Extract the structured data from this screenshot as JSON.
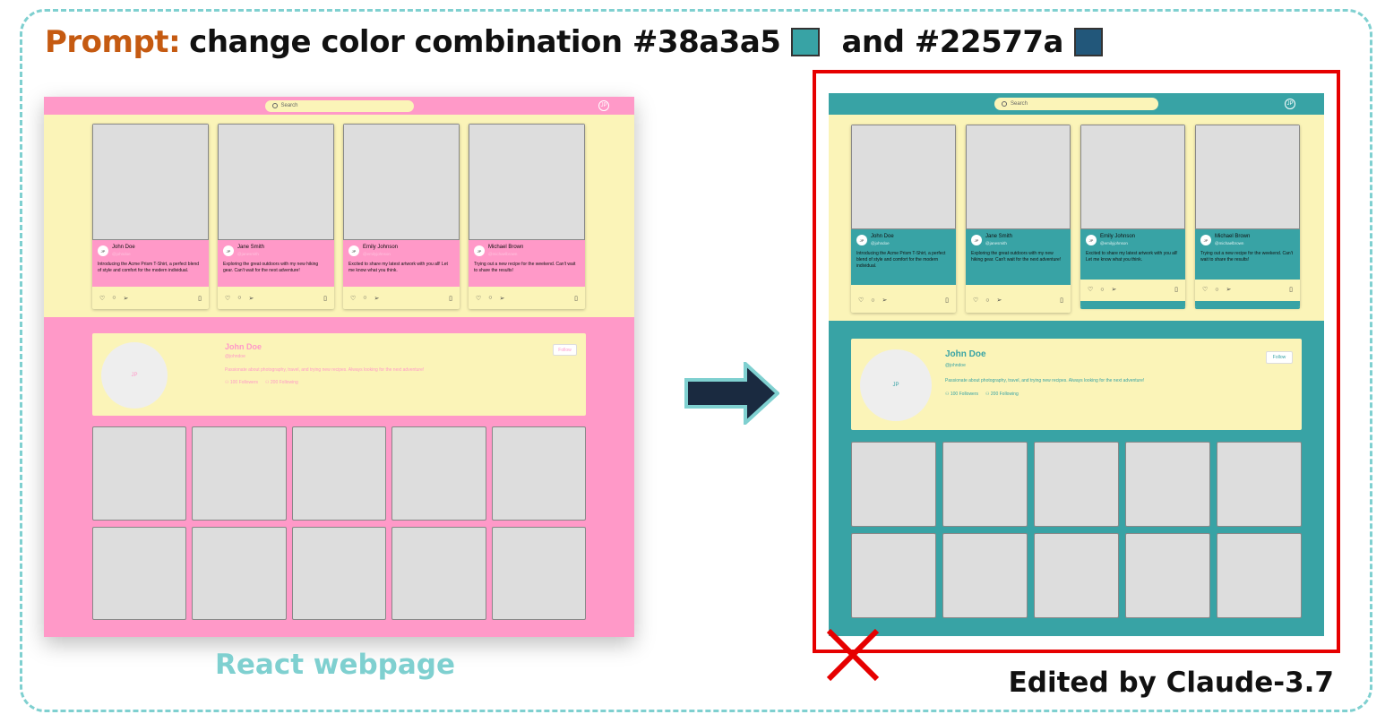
{
  "prompt": {
    "label": "Prompt:",
    "text": "change color combination #38a3a5",
    "and": "and #22577a",
    "swatch1_color": "#38a3a5",
    "swatch2_color": "#22577a"
  },
  "search_placeholder": "Search",
  "user_initials": "JP",
  "posts": [
    {
      "name": "John Doe",
      "handle": "@johndoe",
      "caption": "Introducing the Acme Prism T-Shirt, a perfect blend of style and comfort for the modern individual."
    },
    {
      "name": "Jane Smith",
      "handle": "@janesmith",
      "caption": "Exploring the great outdoors with my new hiking gear. Can't wait for the next adventure!"
    },
    {
      "name": "Emily Johnson",
      "handle": "@emilyjohnson",
      "caption": "Excited to share my latest artwork with you all! Let me know what you think."
    },
    {
      "name": "Michael Brown",
      "handle": "@michaelbrown",
      "caption": "Trying out a new recipe for the weekend. Can't wait to share the results!"
    }
  ],
  "profile": {
    "name": "John Doe",
    "handle": "@johndoe",
    "bio": "Passionate about photography, travel, and trying new recipes. Always looking for the next adventure!",
    "followers": "100 Followers",
    "following": "200 Following",
    "follow_label": "Follow",
    "avatar_initials": "JP"
  },
  "icons": {
    "like": "heart-icon",
    "comment": "comment-icon",
    "share": "send-icon",
    "save": "bookmark-icon"
  },
  "captions": {
    "left": "React webpage",
    "right": "Edited by Claude-3.7"
  },
  "colors": {
    "original_primary": "#ff99c8",
    "secondary": "#fbf4b8",
    "edited_primary": "#38a3a5",
    "frame": "#7fd0d0",
    "highlight": "#e60000"
  }
}
